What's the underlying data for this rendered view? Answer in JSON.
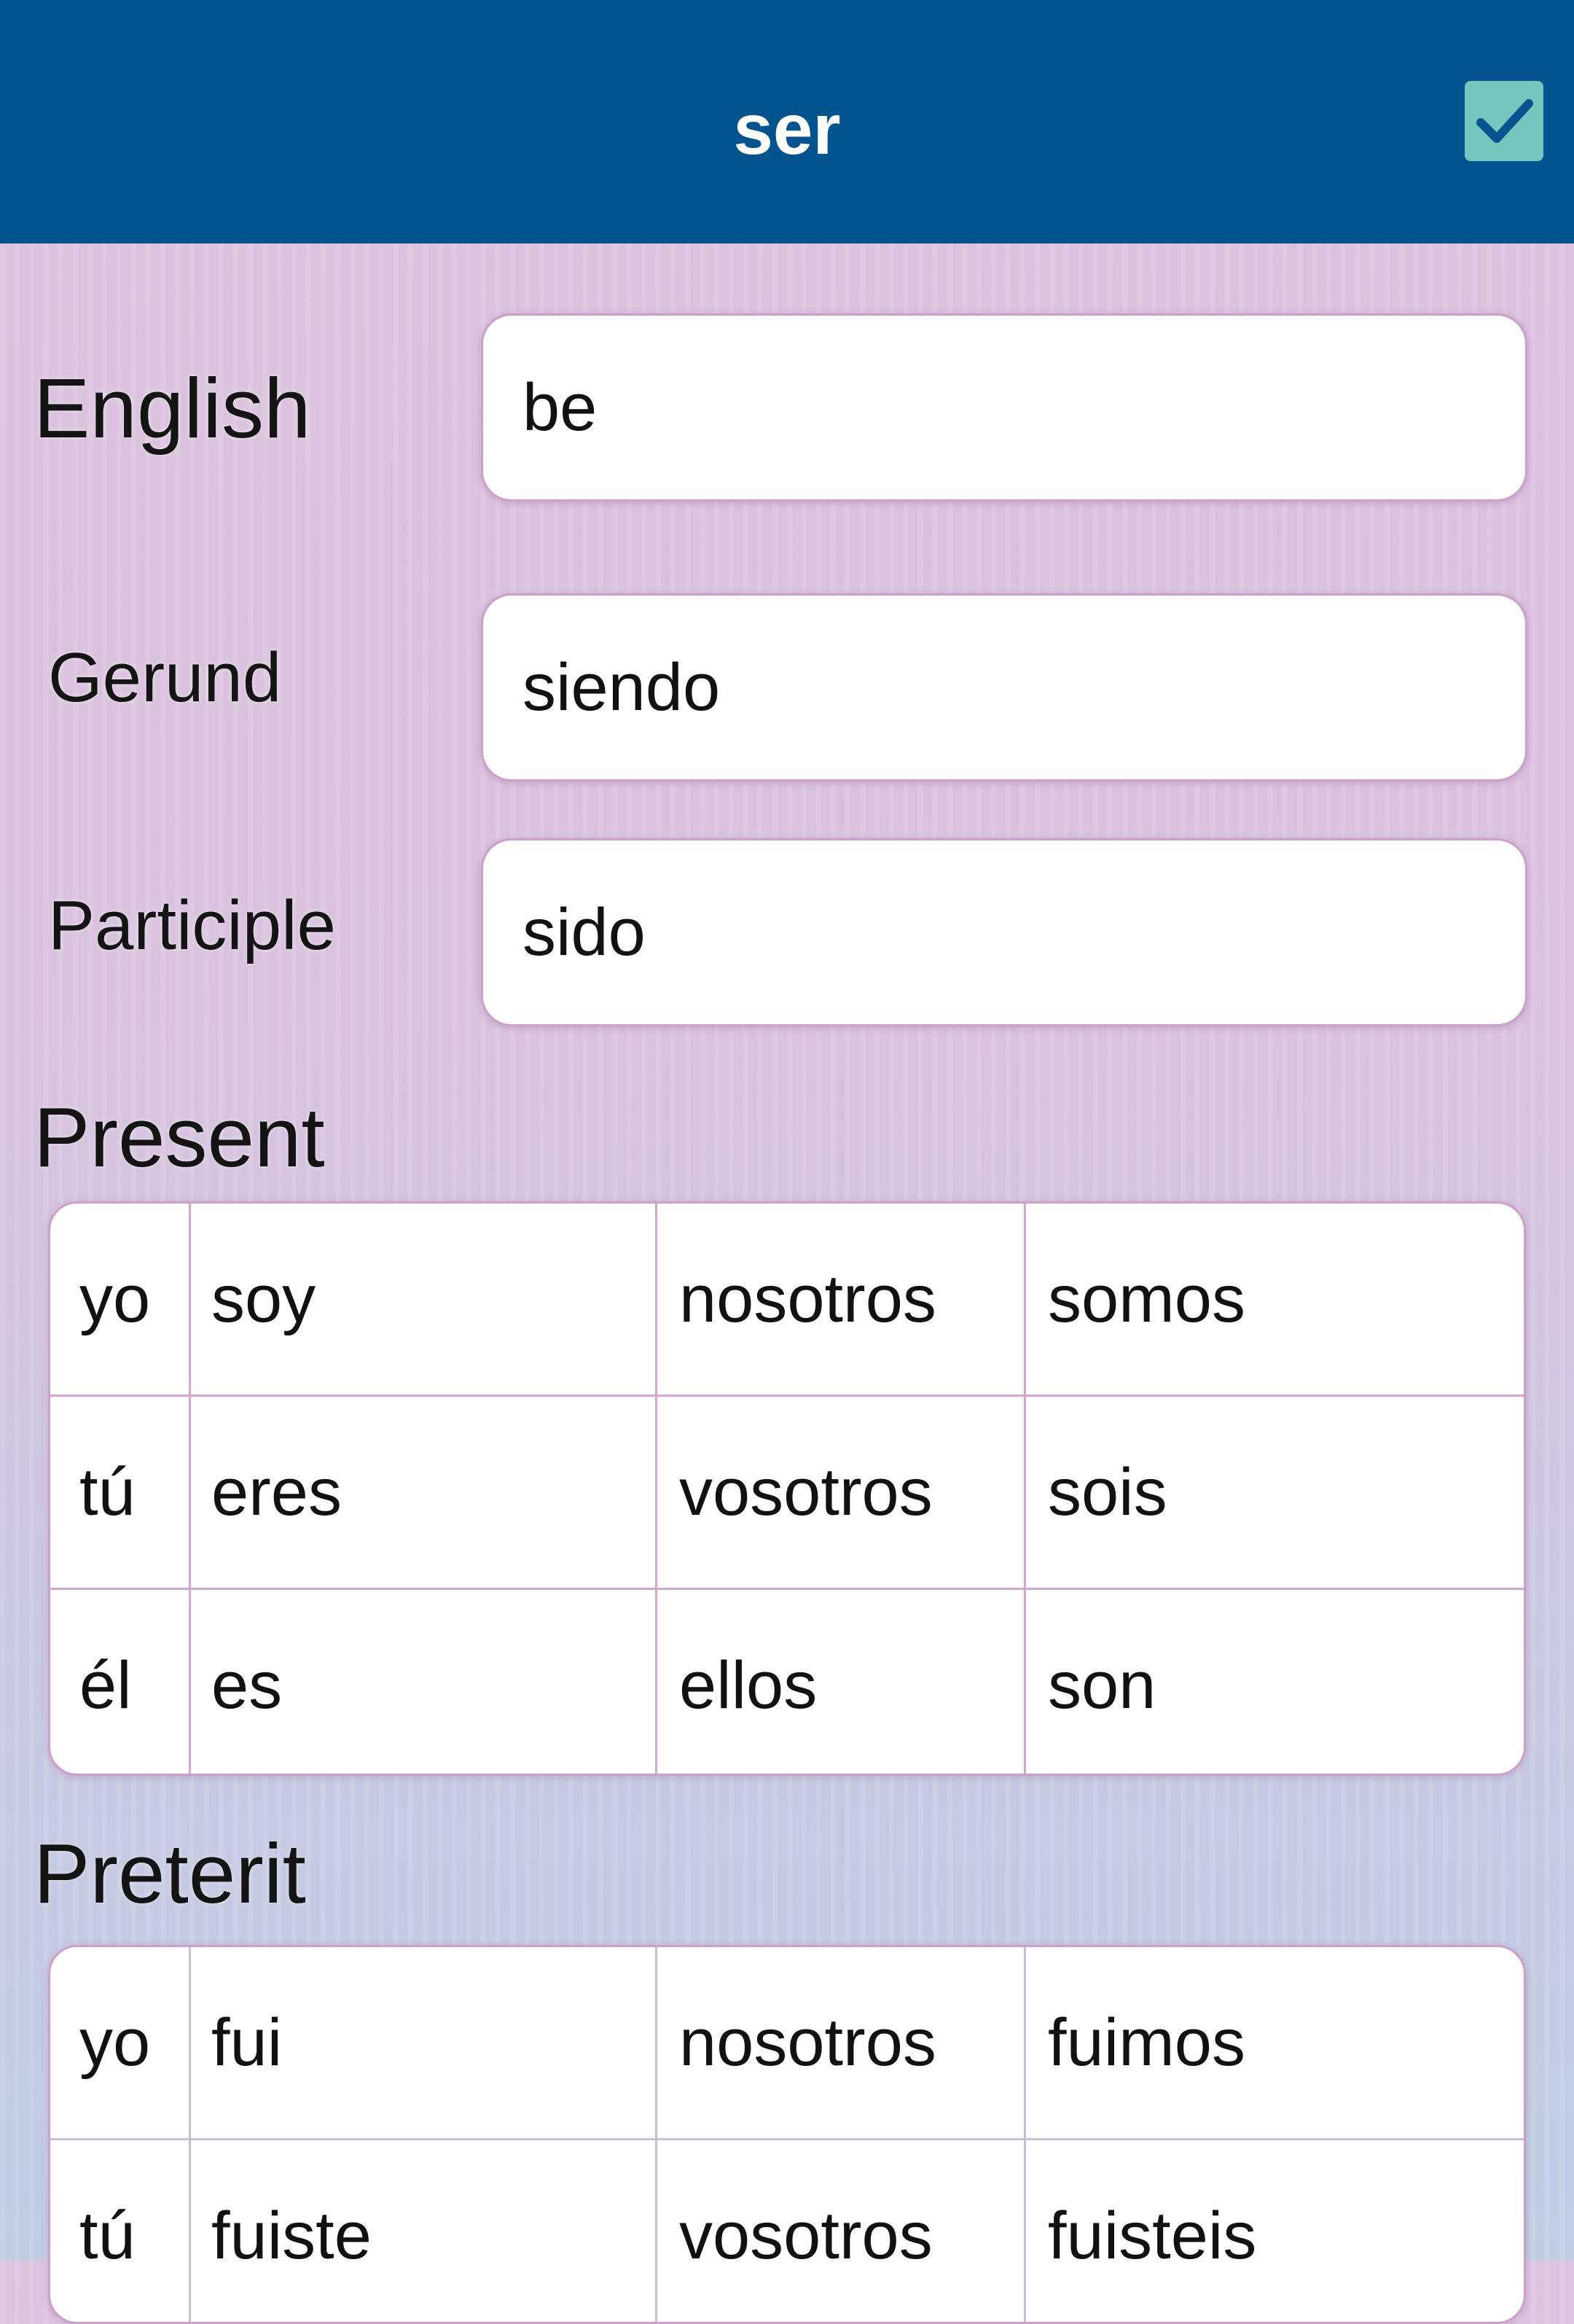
{
  "header": {
    "title": "ser",
    "confirm_icon": "checkmark-icon",
    "background_color": "#02538e",
    "confirm_color": "#76c6c0"
  },
  "fields": {
    "english": {
      "label": "English",
      "value": "be"
    },
    "gerund": {
      "label": "Gerund",
      "value": "siendo"
    },
    "participle": {
      "label": "Participle",
      "value": "sido"
    }
  },
  "present": {
    "title": "Present",
    "rows": [
      {
        "pronoun": "yo",
        "form": "soy",
        "plural_pronoun": "nosotros",
        "plural_form": "somos"
      },
      {
        "pronoun": "tú",
        "form": "eres",
        "plural_pronoun": "vosotros",
        "plural_form": "sois"
      },
      {
        "pronoun": "él",
        "form": "es",
        "plural_pronoun": "ellos",
        "plural_form": "son"
      }
    ]
  },
  "preterit": {
    "title": "Preterit",
    "rows": [
      {
        "pronoun": "yo",
        "form": "fui",
        "plural_pronoun": "nosotros",
        "plural_form": "fuimos"
      },
      {
        "pronoun": "tú",
        "form": "fuiste",
        "plural_pronoun": "vosotros",
        "plural_form": "fuisteis"
      }
    ]
  }
}
